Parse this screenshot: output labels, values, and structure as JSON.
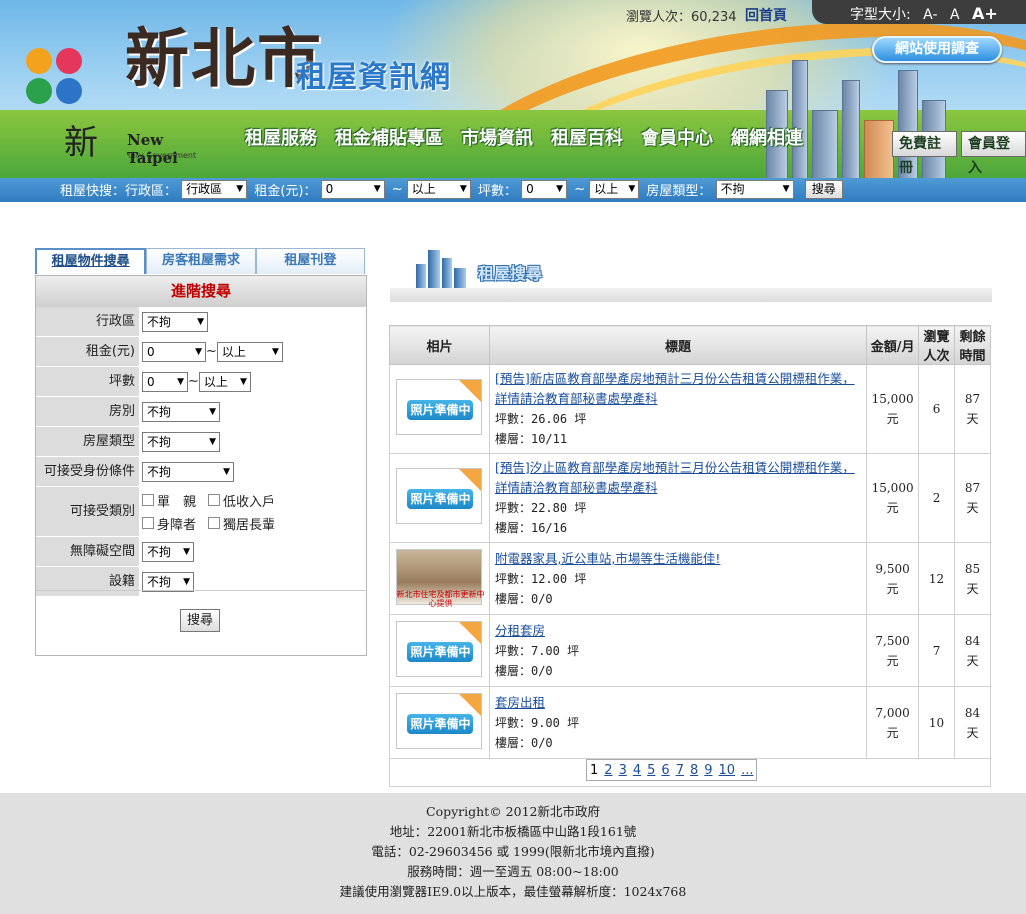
{
  "header": {
    "site_name": "新北市",
    "site_subtitle": "租屋資訊網",
    "visitor_label": "瀏覽人次：",
    "visitor_count": "60,234",
    "home_link": "回首頁",
    "font_size_label": "字型大小:",
    "font_sizes": [
      "A-",
      "A",
      "A+"
    ],
    "survey_button": "網站使用調查",
    "city_logo_cjk": "新",
    "city_logo_en": "New Taipei",
    "city_logo_en2": "City Government"
  },
  "nav": {
    "items": [
      "租屋服務",
      "租金補貼專區",
      "市場資訊",
      "租屋百科",
      "會員中心",
      "網網相連"
    ],
    "register": "免費註冊",
    "login": "會員登入"
  },
  "quick_search": {
    "label": "租屋快搜：",
    "district_label": "行政區：",
    "district_value": "行政區",
    "rent_label": "租金(元)：",
    "rent_min": "0",
    "tilde": "~",
    "rent_max": "以上",
    "area_label": "坪數：",
    "area_min": "0",
    "area_max": "以上",
    "type_label": "房屋類型：",
    "type_value": "不拘",
    "button": "搜尋"
  },
  "left": {
    "tabs": [
      "租屋物件搜尋",
      "房客租屋需求",
      "租屋刊登"
    ],
    "panel_title": "進階搜尋",
    "fields": {
      "district": {
        "label": "行政區",
        "value": "不拘"
      },
      "rent": {
        "label": "租金(元)",
        "min": "0",
        "max": "以上"
      },
      "area": {
        "label": "坪數",
        "min": "0",
        "max": "以上"
      },
      "room_type": {
        "label": "房別",
        "value": "不拘"
      },
      "house_type": {
        "label": "房屋類型",
        "value": "不拘"
      },
      "identity": {
        "label": "可接受身份條件",
        "value": "不拘"
      },
      "accept": {
        "label": "可接受類別",
        "options": [
          "單　親",
          "低收入戶",
          "身障者",
          "獨居長輩"
        ]
      },
      "barrier_free": {
        "label": "無障礙空間",
        "value": "不拘"
      },
      "registration": {
        "label": "設籍",
        "value": "不拘"
      }
    },
    "search_button": "搜尋"
  },
  "right": {
    "section_title": "租屋搜尋",
    "columns": {
      "photo": "相片",
      "title": "標題",
      "amount": "金額/月",
      "views": "瀏覽人次",
      "remaining": "剩餘時間"
    },
    "placeholder_badge": "照片準備中",
    "real_photo_caption": "新北市住宅及都市更新中心提供",
    "area_prefix": "坪數：",
    "area_suffix": " 坪",
    "floor_prefix": "樓層：",
    "currency": "元",
    "day": "天",
    "listings": [
      {
        "title": "[預告]新店區教育部學產房地預計三月份公告租賃公開標租作業，詳情請洽教育部秘書處學產科",
        "area": "26.06",
        "floor": "10/11",
        "amount": "15,000",
        "views": "6",
        "remaining": "87",
        "photo": "placeholder"
      },
      {
        "title": "[預告]汐止區教育部學產房地預計三月份公告租賃公開標租作業，詳情請洽教育部秘書處學產科",
        "area": "22.80",
        "floor": "16/16",
        "amount": "15,000",
        "views": "2",
        "remaining": "87",
        "photo": "placeholder"
      },
      {
        "title": "附電器家具,近公車站,市場等生活機能佳!",
        "area": "12.00",
        "floor": "0/0",
        "amount": "9,500",
        "views": "12",
        "remaining": "85",
        "photo": "real"
      },
      {
        "title": "分租套房",
        "area": "7.00",
        "floor": "0/0",
        "amount": "7,500",
        "views": "7",
        "remaining": "84",
        "photo": "placeholder"
      },
      {
        "title": "套房出租",
        "area": "9.00",
        "floor": "0/0",
        "amount": "7,000",
        "views": "10",
        "remaining": "84",
        "photo": "placeholder"
      }
    ],
    "pager": [
      "1",
      "2",
      "3",
      "4",
      "5",
      "6",
      "7",
      "8",
      "9",
      "10",
      "..."
    ]
  },
  "footer": {
    "copyright": "Copyright© 2012新北市政府",
    "address": "地址：22001新北市板橋區中山路1段161號",
    "phone": "電話：02-29603456 或 1999(限新北市境內直撥)",
    "hours": "服務時間：週一至週五 08:00~18:00",
    "browser": "建議使用瀏覽器IE9.0以上版本，最佳螢幕解析度：1024x768"
  }
}
